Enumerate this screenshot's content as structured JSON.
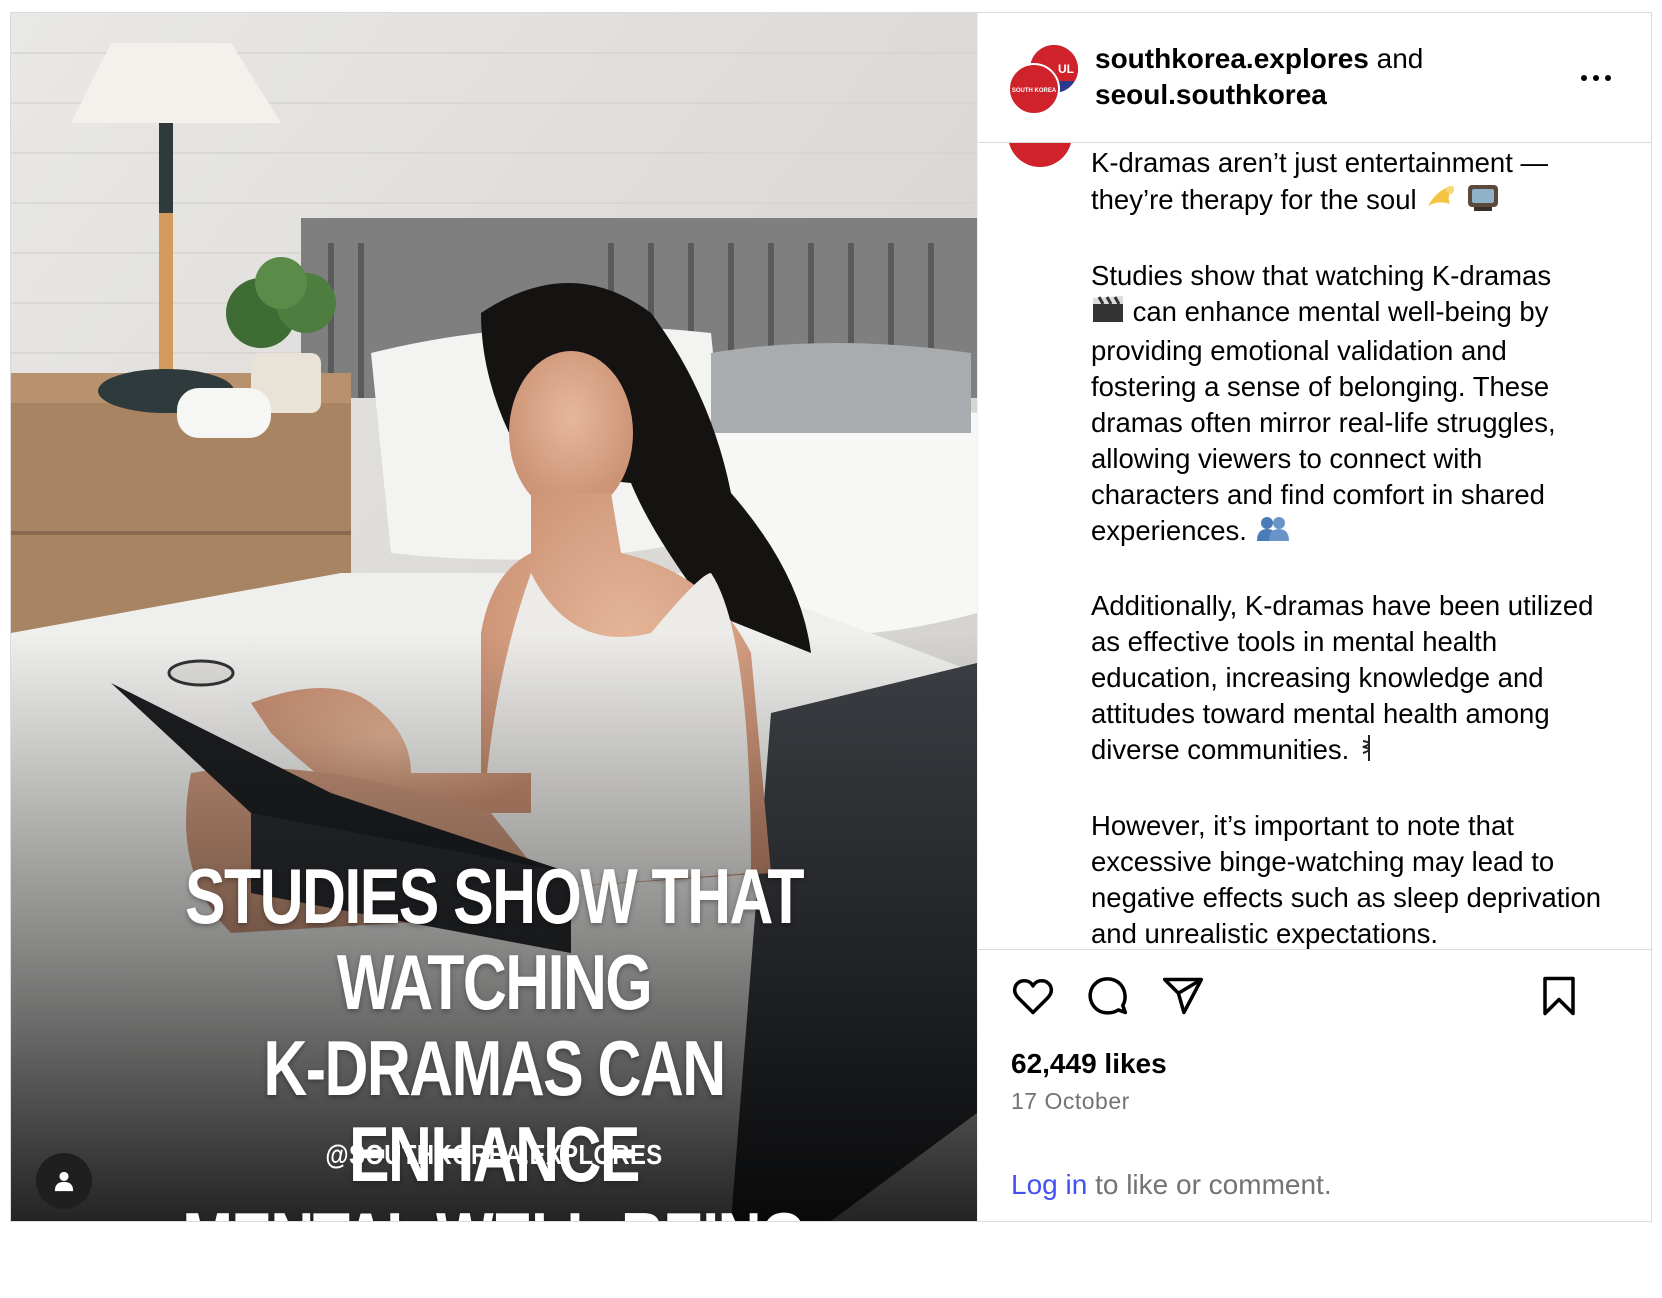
{
  "media": {
    "headline_lines": [
      "STUDIES SHOW THAT WATCHING",
      "K-DRAMAS CAN ENHANCE",
      "MENTAL WELL-BEING"
    ],
    "handle": "@SOUTHKOREA.EXPLORES"
  },
  "header": {
    "account1": "southkorea.explores",
    "joiner": " and",
    "account2": "seoul.southkorea",
    "avatar_front_text": "SOUTH KOREA",
    "avatar_back_text": "UL"
  },
  "caption": {
    "p1_line1": "K-dramas aren’t just entertainment —",
    "p1_line2": "they’re therapy for the soul",
    "p2_a": "Studies show that watching K-dramas",
    "p2_b": "can enhance mental well-being by providing emotional validation and fostering a sense of belonging. These dramas often mirror real-life struggles, allowing viewers to connect with characters and find comfort in shared experiences.",
    "p3": "Additionally, K-dramas have been utilized as effective tools in mental health education, increasing knowledge and attitudes toward mental health among diverse communities.",
    "p4": "However, it’s important to note that excessive binge-watching may lead to negative effects such as sleep deprivation and unrealistic expectations."
  },
  "stats": {
    "likes": "62,449 likes",
    "date": "17 October"
  },
  "login": {
    "link": "Log in",
    "rest": " to like or comment."
  },
  "icons": [
    "like-icon",
    "comment-icon",
    "share-icon",
    "save-icon",
    "more-icon",
    "user-tag-icon"
  ],
  "colors": {
    "login_link": "#4150f7",
    "muted": "#737373",
    "avatar_red": "#d0222b",
    "avatar_blue": "#2b3a8f"
  }
}
